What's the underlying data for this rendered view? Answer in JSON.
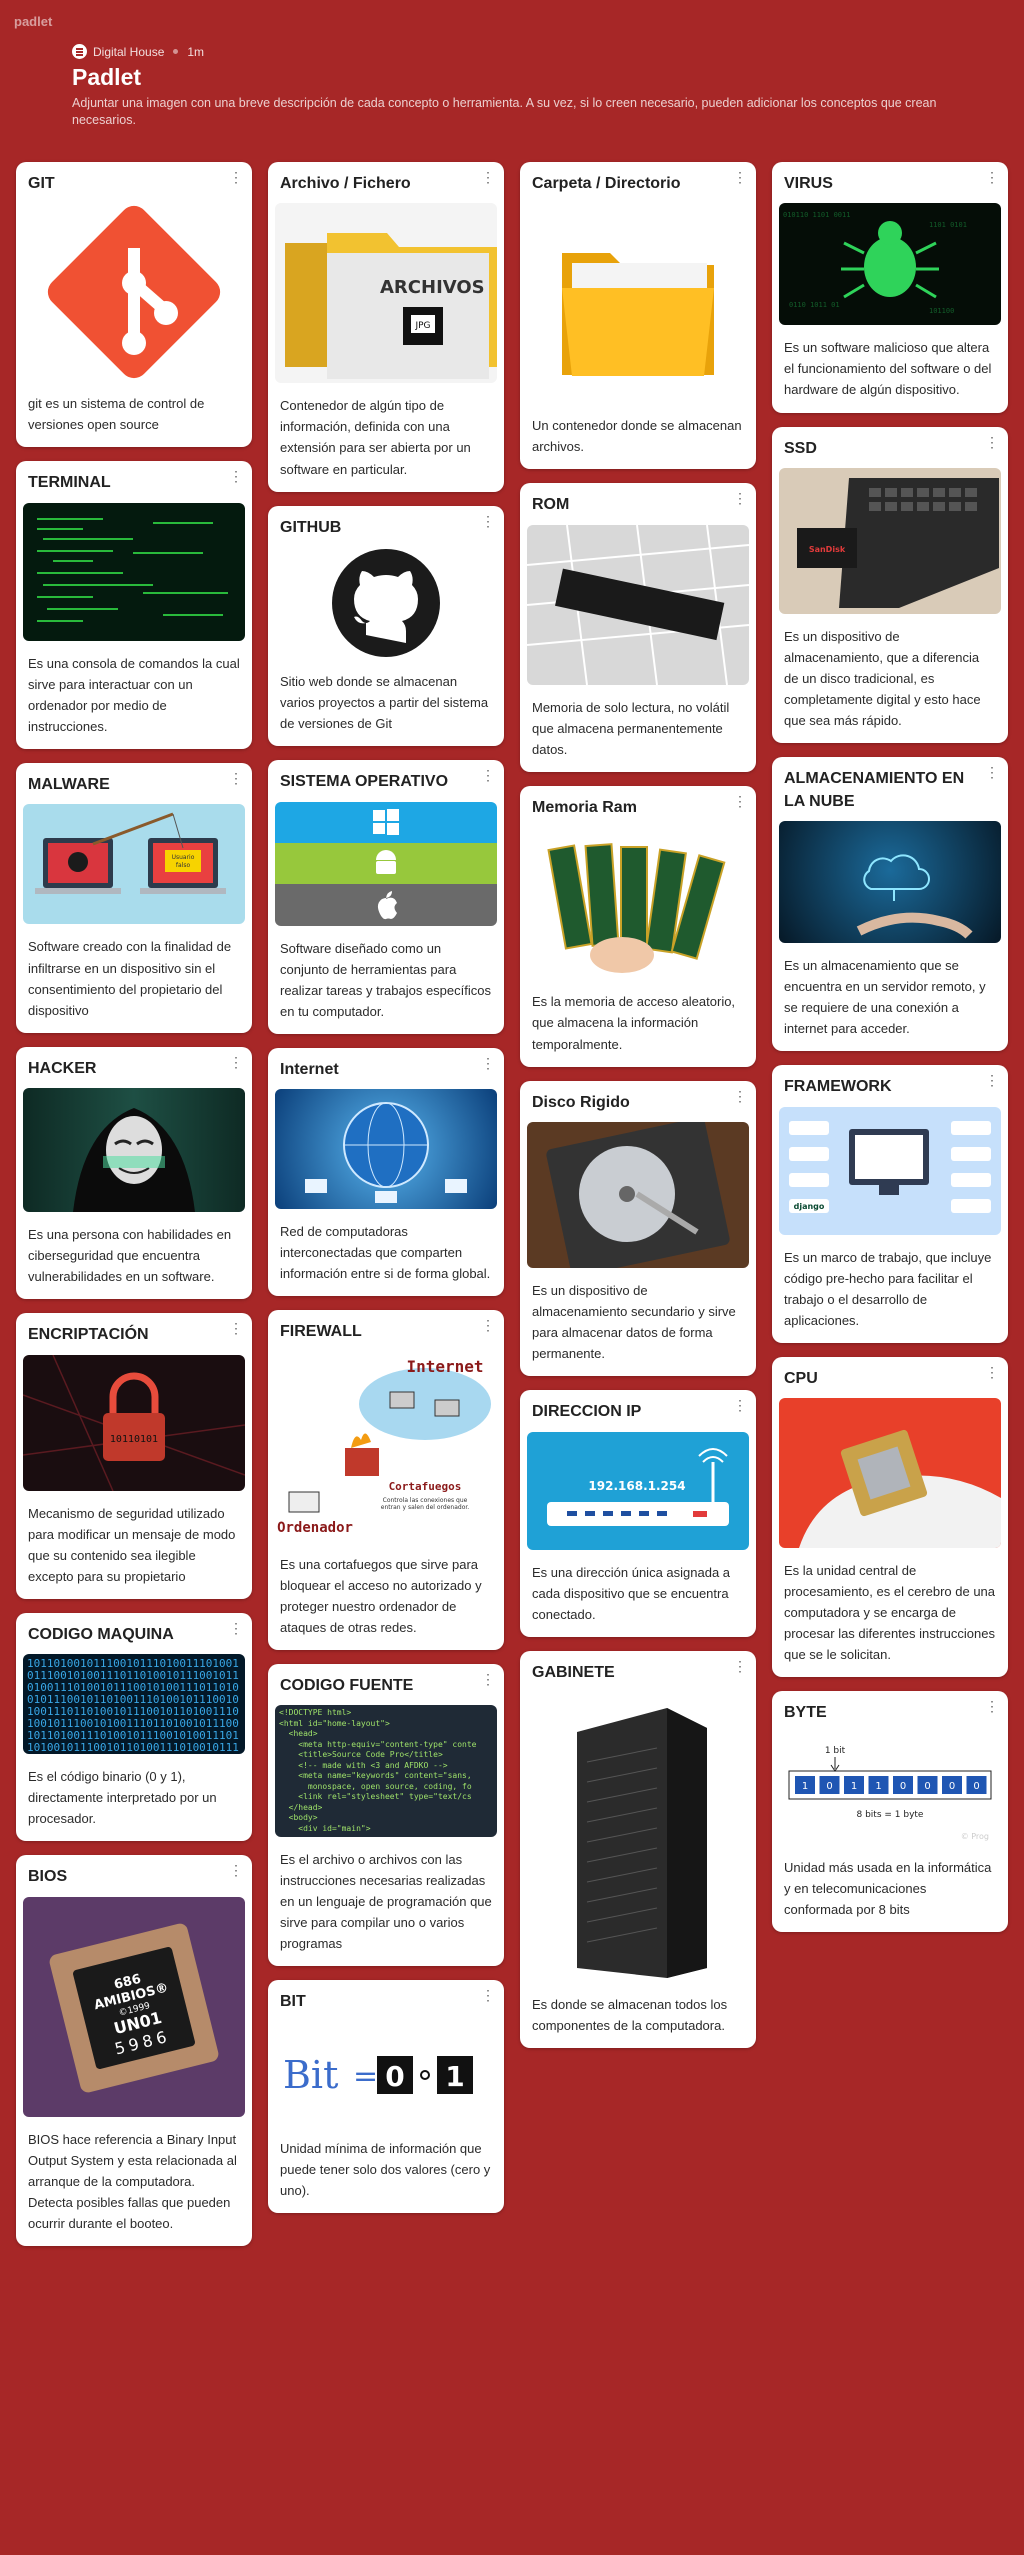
{
  "app": {
    "brand": "padlet"
  },
  "header": {
    "author": "Digital House",
    "time": "1m",
    "title": "Padlet",
    "description": "Adjuntar una imagen con una breve descripción de cada concepto o herramienta. A su vez, si lo creen necesario, pueden adicionar los conceptos que crean necesarios."
  },
  "cards": {
    "git": {
      "title": "GIT",
      "text": "git es un sistema de control de versiones open source"
    },
    "terminal": {
      "title": "TERMINAL",
      "text": "Es una consola de comandos la cual sirve para interactuar con un ordenador por medio de instrucciones."
    },
    "malware": {
      "title": "MALWARE",
      "text": "Software creado con la finalidad de infiltrarse en un dispositivo sin el consentimiento del propietario del dispositivo",
      "img_text": "Usuario\nfalso"
    },
    "hacker": {
      "title": "HACKER",
      "text": "Es una persona con habilidades en ciberseguridad que encuentra vulnerabilidades en un software."
    },
    "encriptacion": {
      "title": "ENCRIPTACIÓN",
      "text": "Mecanismo de seguridad utilizado para modificar un mensaje de modo que su contenido sea ilegible excepto para su propietario",
      "img_text": "10110101"
    },
    "codigo_maquina": {
      "title": "CODIGO MAQUINA",
      "text": "Es el código binario (0 y 1), directamente interpretado por un procesador."
    },
    "bios": {
      "title": "BIOS",
      "text": "BIOS hace referencia a Binary Input Output System y esta relacionada al arranque de la computadora. Detecta posibles fallas que pueden ocurrir durante el booteo.",
      "chip_line1": "686",
      "chip_line2": "AMIBIOS®",
      "chip_line3": "©1999",
      "chip_line4": "UN01",
      "chip_line5": "5986"
    },
    "archivo": {
      "title": "Archivo / Fichero",
      "text": "Contenedor de algún tipo de información, definida con una extensión para ser abierta por un software en particular.",
      "img_label": "ARCHIVOS",
      "img_badge": "JPG"
    },
    "github": {
      "title": "GITHUB",
      "text": "Sitio web donde se almacenan varios proyectos a partir del sistema de versiones de Git"
    },
    "so": {
      "title": "SISTEMA OPERATIVO",
      "text": "Software diseñado como un conjunto de herramientas para realizar tareas y trabajos específicos en tu computador."
    },
    "internet": {
      "title": "Internet",
      "text": "Red de computadoras interconectadas que comparten información entre si de forma global."
    },
    "firewall": {
      "title": "FIREWALL",
      "text": "Es una cortafuegos que sirve para bloquear el acceso no autorizado y proteger nuestro ordenador de ataques de otras redes.",
      "img_internet": "Internet",
      "img_cortafuegos": "Cortafuegos",
      "img_cortafuegos_desc": "Controla las conexiones que\nentran y salen del ordenador.",
      "img_ordenador": "Ordenador"
    },
    "codigo_fuente": {
      "title": "CODIGO FUENTE",
      "text": "Es el archivo o archivos con las instrucciones necesarias realizadas en un lenguaje de programación que sirve para compilar uno o varios programas",
      "code": [
        "<!DOCTYPE html>",
        "<html id=\"home-layout\">",
        "  <head>",
        "    <meta http-equiv=\"content-type\" conte",
        "    <title>Source Code Pro</title>",
        "    <!-- made with <3 and AFDKO -->",
        "    <meta name=\"keywords\" content=\"sans,",
        "      monospace, open source, coding, fo",
        "    <link rel=\"stylesheet\" type=\"text/cs",
        "  </head>",
        "  <body>",
        "    <div id=\"main\">"
      ]
    },
    "bit": {
      "title": "BIT",
      "text": "Unidad mínima de información que puede tener solo dos valores (cero y uno).",
      "img_word": "Bit",
      "img_eq": "=",
      "img_zero": "0",
      "img_one": "1"
    },
    "carpeta": {
      "title": "Carpeta / Directorio",
      "text": "Un contenedor donde se almacenan archivos."
    },
    "rom": {
      "title": "ROM",
      "text": "Memoria de solo lectura, no volátil que almacena permanentemente datos."
    },
    "ram": {
      "title": "Memoria Ram",
      "text": "Es la memoria de acceso aleatorio, que almacena la información temporalmente."
    },
    "disco": {
      "title": "Disco Rigido",
      "text": "Es un dispositivo de almacenamiento secundario y sirve para almacenar datos de forma permanente."
    },
    "ip": {
      "title": "DIRECCION IP",
      "text": "Es una dirección única asignada a cada dispositivo que se encuentra conectado.",
      "img_ip": "192.168.1.254"
    },
    "gabinete": {
      "title": "GABINETE",
      "text": "Es donde se almacenan todos los componentes de la computadora."
    },
    "virus": {
      "title": "VIRUS",
      "text": "Es un software malicioso que altera el funcionamiento del software o del hardware de algún dispositivo."
    },
    "ssd": {
      "title": "SSD",
      "text": "Es un dispositivo de almacenamiento, que a diferencia de un disco tradicional, es completamente digital y esto hace que sea más rápido.",
      "img_brand": "SanDisk"
    },
    "nube": {
      "title": "ALMACENAMIENTO EN LA NUBE",
      "text": "Es un almacenamiento que se encuentra en un servidor remoto, y se requiere de una conexión a internet para acceder."
    },
    "framework": {
      "title": "FRAMEWORK",
      "text": "Es un marco de trabajo, que incluye código pre-hecho para facilitar el trabajo o el desarrollo de aplicaciones.",
      "img_django": "django"
    },
    "cpu": {
      "title": "CPU",
      "text": "Es la unidad central de procesamiento, es el cerebro de una computadora y se encarga de procesar las diferentes instrucciones que se le solicitan."
    },
    "byte": {
      "title": "BYTE",
      "text": "Unidad más usada en la informática y en telecomunicaciones conformada por 8 bits",
      "img_bit_label": "1 bit",
      "img_bits": [
        "1",
        "0",
        "1",
        "1",
        "0",
        "0",
        "0",
        "0"
      ],
      "img_caption": "8 bits = 1 byte",
      "img_watermark": "© Prog"
    }
  }
}
